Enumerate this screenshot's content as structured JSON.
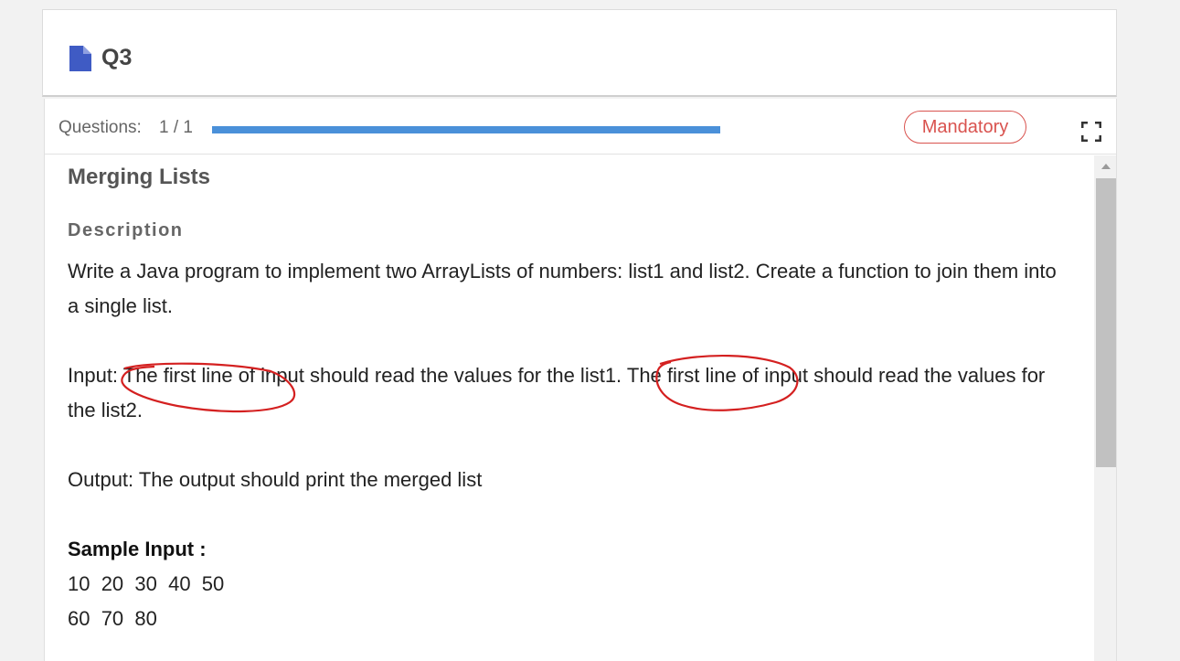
{
  "header": {
    "title": "Q3",
    "icon": "document-icon",
    "icon_color": "#3f5bc4"
  },
  "question_bar": {
    "label": "Questions:",
    "count": "1 / 1",
    "progress": 1.0,
    "progress_color": "#4a90d9",
    "badge": "Mandatory",
    "badge_color": "#d9534f",
    "fullscreen_icon": "fullscreen-icon"
  },
  "problem": {
    "title": "Merging Lists",
    "description_heading": "Description",
    "paragraph_1": "Write a Java program to implement two ArrayLists of numbers: list1 and list2. Create a function to join them into a single list.",
    "paragraph_2": "Input: The first line of input should read the values for the list1. The first line of input should read the values for the list2.",
    "paragraph_3": "Output: The output should print the merged list",
    "sample_input_heading": "Sample Input :",
    "sample_input_lines": [
      "10  20  30  40  50",
      "60  70  80"
    ]
  },
  "annotations": {
    "color": "#d42020"
  }
}
